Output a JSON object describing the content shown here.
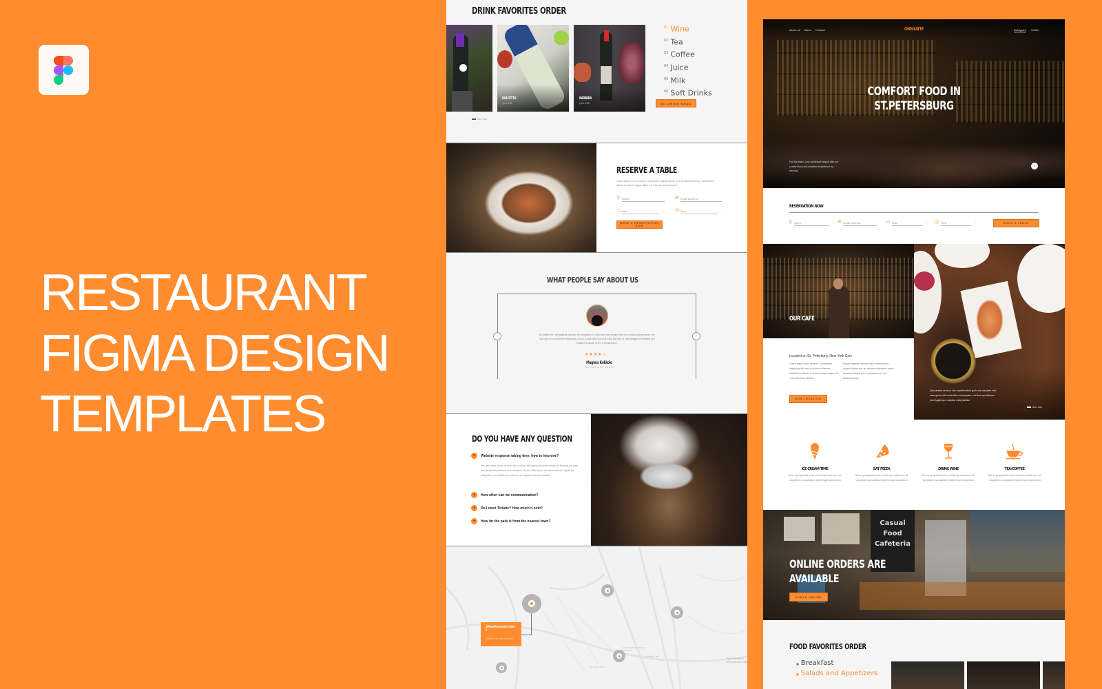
{
  "promo": {
    "logo": "figma-logo",
    "title_lines": [
      "RESTAURANT",
      "FIGMA DESIGN",
      "TEMPLATES"
    ],
    "brand_color": "#ff8c2f"
  },
  "left_page": {
    "drinks": {
      "heading": "DRINK FAVORITES ORDER",
      "cards": [
        {
          "name": "",
          "price": ""
        },
        {
          "name": "DOLCETTO",
          "price": "price 20$"
        },
        {
          "name": "BARBERA",
          "price": "price 20$"
        }
      ],
      "menu": [
        {
          "num": "01",
          "label": "Wine",
          "active": true
        },
        {
          "num": "02",
          "label": "Tea"
        },
        {
          "num": "03",
          "label": "Coffee"
        },
        {
          "num": "04",
          "label": "Juice"
        },
        {
          "num": "05",
          "label": "Milk"
        },
        {
          "num": "06",
          "label": "Soft Drinks"
        }
      ],
      "button": "GO DRINK MENU"
    },
    "reserve": {
      "heading": "RESERVE A TABLE",
      "text": "Lorem ipsum dolor sit amet, consectetur adipiscing elit, sed do eiusmod tempor incididunt ut labore et dolore magna aliqua. Ut enim ad minim veniam",
      "fields": {
        "name": "Name",
        "email": "Email Address",
        "date": "Date",
        "time": "Time"
      },
      "button": "MAKE A RESERVATION NOW"
    },
    "testimonials": {
      "heading": "WHAT PEOPLE SAY ABOUT US",
      "quote": "As twilight fell, still gaining velocity, the palpitation of night and day merged into one continuous greyness; the sky took on a wonderful deepness of blue, a splendid luminous color like that of early twilight; the jerking sun became a streak of fire, a brilliant arch.",
      "rating": 4,
      "rating_max": 5,
      "name": "Magnus Kokkolo",
      "role": "Restaurant expert",
      "prev": "‹",
      "next": "›"
    },
    "faq": {
      "heading": "DO YOU HAVE ANY QUESTION",
      "items": [
        {
          "q": "Website response taking time, how to improve?",
          "open": true,
          "a": "Yes, you need tickets to enter into our site. We spend the ticket money for keeping our park and its animal protected from intruders. On the other hand, we denounce with righteous indignation and dislike men who are so beguiled and demoralized."
        },
        {
          "q": "How often can we communication?"
        },
        {
          "q": "Do I need Tickets? How much it cost?"
        },
        {
          "q": "How far the park is from the nearest town?"
        }
      ]
    },
    "map": {
      "popup_title": "SFFood Restaurant Outlet 2",
      "popup_sub": "15km From Your Location",
      "labels": [
        "Lomita Park",
        "San Bruno Park",
        "Howard Johnson Express San Bruno",
        "San Francisco International Airport"
      ]
    }
  },
  "right_page": {
    "nav": {
      "left": [
        "About us",
        "Menu",
        "Contact"
      ],
      "brand": "CHOULATTE",
      "right": [
        "Instagram",
        "Twitter"
      ]
    },
    "hero": {
      "title_lines": [
        "COMFORT FOOD IN",
        "ST.PETERSBURG"
      ],
      "text": "Exit the bistro, your adventure begins with our comfort food and excellent experience by dancing"
    },
    "reservation": {
      "heading": "RESERVATION NOW",
      "fields": {
        "name": "Name",
        "email": "Email Address",
        "date": "Date",
        "time": "Time"
      },
      "button": "BOOK A TABLE"
    },
    "cafe": {
      "label": "OUR CAFE",
      "location": "Located on St. Peterburg, New York Coty",
      "col1": "Lorem ipsum dolor sit amet, consectetur adipiscing elit, sed do eiusmod tempor incididunt ut labore et dolore magna aliqua. Ut enim ad minim veniam",
      "col2": "Fugiat magnam dolores quia consequuntur magni dolores eos qui ratione voluptatem sequi nesciunt. Neque porro quisquam est, qui dolorem ipsum",
      "button": "OUR LOCATION",
      "caption": "Quis autem vel eum iure reprehenderit qui in ea voluptate velit esse quam nihil molestiae consequatur, vel illum qui dolorem eum fugiat quo voluptas nulla pariatur"
    },
    "services": [
      {
        "icon": "ice-cream-icon",
        "title": "ICE CREAM TIME",
        "text": "Sed ut perspiciatis unde omnis iste natus error sit voluptatem accusantium doloremque laudantium"
      },
      {
        "icon": "pizza-icon",
        "title": "EAT PIZZA",
        "text": "Sed ut perspiciatis unde omnis iste natus error sit voluptatem accusantium doloremque laudantium"
      },
      {
        "icon": "wine-glass-icon",
        "title": "DRINK WINE",
        "text": "Sed ut perspiciatis unde omnis iste natus error sit voluptatem accusantium doloremque laudantium"
      },
      {
        "icon": "coffee-cup-icon",
        "title": "TEA/COFFEE",
        "text": "Sed ut perspiciatis unde omnis iste natus error sit voluptatem accusantium doloremque laudantium"
      }
    ],
    "online": {
      "title_lines": [
        "ONLINE ORDERS ARE",
        "AVAILABLE"
      ],
      "sign_lines": [
        "Casual",
        "Food",
        "Cafeteria"
      ],
      "button": "ORDER ONLINE"
    },
    "food": {
      "heading": "FOOD FAVORITES ORDER",
      "menu": [
        {
          "label": "Breakfast"
        },
        {
          "label": "Salads and Appetizers",
          "active": true
        }
      ]
    }
  }
}
